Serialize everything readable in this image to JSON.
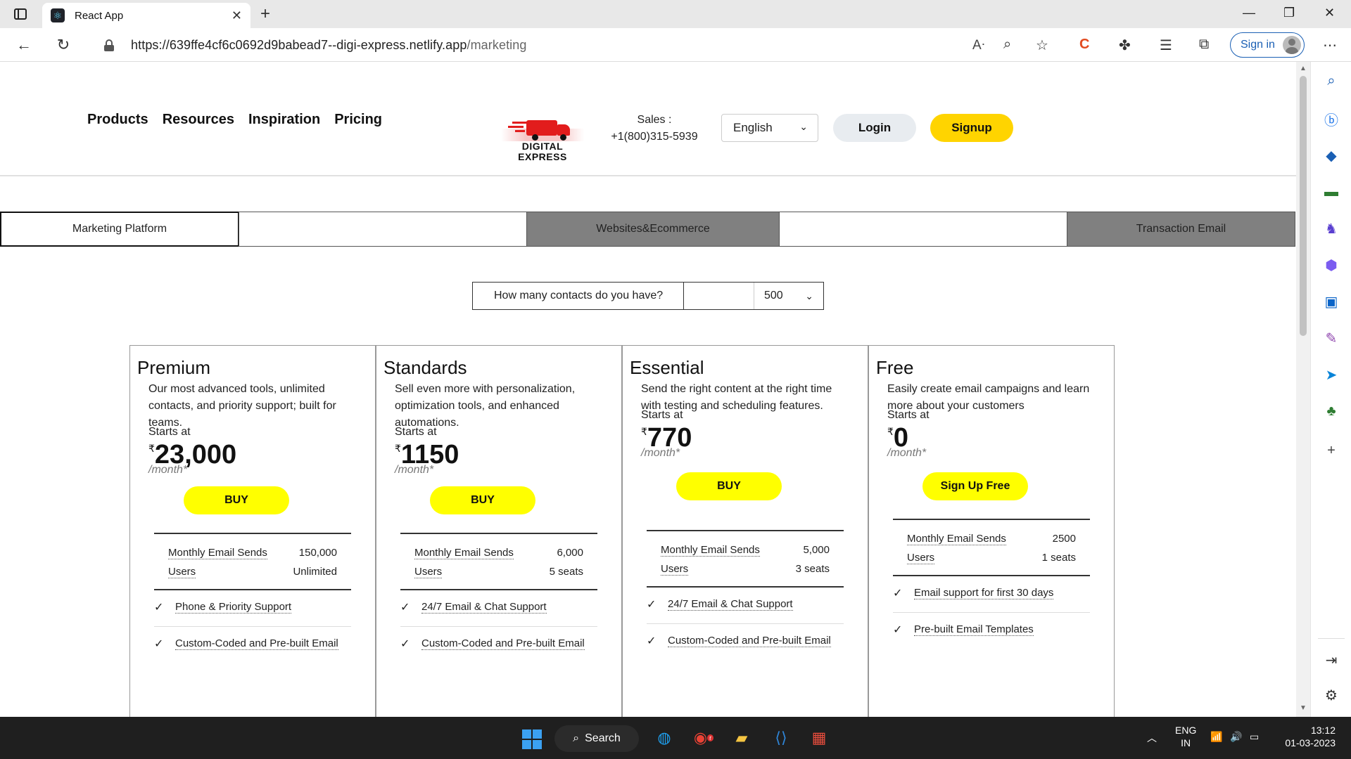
{
  "browser": {
    "tab_title": "React App",
    "tab_close": "✕",
    "new_tab": "+",
    "url_host": "https://639ffe4cf6c0692d9babead7--digi-express.netlify.app",
    "url_path": "/marketing",
    "signin_label": "Sign in",
    "window_controls": [
      "—",
      "❐",
      "✕"
    ]
  },
  "header": {
    "nav": [
      "Products",
      "Resources",
      "Inspiration",
      "Pricing"
    ],
    "logo_line1": "DIGITAL",
    "logo_line2": "EXPRESS",
    "sales_label": "Sales :",
    "sales_phone": "+1(800)315-5939",
    "language": "English",
    "login": "Login",
    "signup": "Signup"
  },
  "category_tabs": [
    "Marketing Platform",
    "",
    "Websites&Ecommerce",
    "",
    "Transaction Email"
  ],
  "contacts": {
    "question": "How many contacts do you have?",
    "value": "500"
  },
  "currency_symbol": "₹",
  "plans": [
    {
      "name": "Premium",
      "description": "Our most advanced tools, unlimited contacts, and priority support; built for teams.",
      "starts_at": "Starts at",
      "price": "23,000",
      "per_month": "/month*",
      "cta": "BUY",
      "stats": [
        {
          "label": "Monthly Email Sends",
          "value": "150,000"
        },
        {
          "label": "Users",
          "value": "Unlimited"
        }
      ],
      "features": [
        "Phone & Priority Support",
        "Custom-Coded and Pre-built Email"
      ]
    },
    {
      "name": "Standards",
      "description": "Sell even more with personalization, optimization tools, and enhanced automations.",
      "starts_at": "Starts at",
      "price": "1150",
      "per_month": "/month*",
      "cta": "BUY",
      "stats": [
        {
          "label": "Monthly Email Sends",
          "value": "6,000"
        },
        {
          "label": "Users",
          "value": "5 seats"
        }
      ],
      "features": [
        "24/7 Email & Chat Support",
        "Custom-Coded and Pre-built Email"
      ]
    },
    {
      "name": "Essential",
      "description": "Send the right content at the right time with testing and scheduling features.",
      "starts_at": "Starts at",
      "price": "770",
      "per_month": "/month*",
      "cta": "BUY",
      "stats": [
        {
          "label": "Monthly Email Sends",
          "value": "5,000"
        },
        {
          "label": "Users",
          "value": "3 seats"
        }
      ],
      "features": [
        "24/7 Email & Chat Support",
        "Custom-Coded and Pre-built Email"
      ]
    },
    {
      "name": "Free",
      "description": "Easily create email campaigns and learn more about your customers",
      "starts_at": "Starts at",
      "price": "0",
      "per_month": "/month*",
      "cta": "Sign Up Free",
      "stats": [
        {
          "label": "Monthly Email Sends",
          "value": "2500"
        },
        {
          "label": "Users",
          "value": "1 seats"
        }
      ],
      "features": [
        "Email support for first 30 days",
        "Pre-built Email Templates"
      ]
    }
  ],
  "taskbar": {
    "search": "Search",
    "lang_line1": "ENG",
    "lang_line2": "IN",
    "time": "13:12",
    "date": "01-03-2023",
    "chrome_badge": "r"
  },
  "colors": {
    "buy_button": "#ffff00",
    "signup_button": "#ffd400",
    "dark_tab": "#808080",
    "signin_blue": "#1a5fb4"
  }
}
